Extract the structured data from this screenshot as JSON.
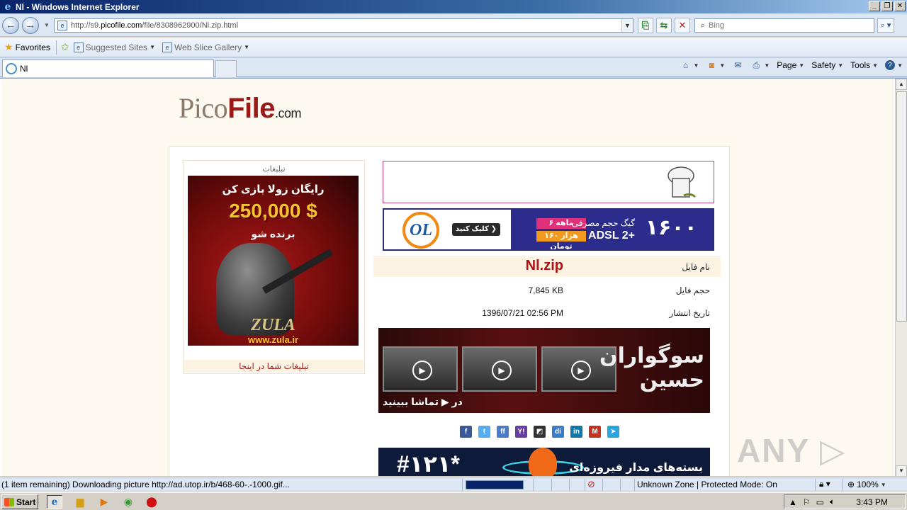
{
  "window": {
    "title": "Nl - Windows Internet Explorer",
    "controls": [
      "_",
      "❐",
      "✕"
    ]
  },
  "address_bar": {
    "url_prefix": "http://s9.",
    "url_domain": "picofile.com",
    "url_path": "/file/8308962900/Nl.zip.html",
    "search_placeholder": "Bing"
  },
  "favorites_bar": {
    "favorites_label": "Favorites",
    "suggested_sites": "Suggested Sites",
    "web_slice_gallery": "Web Slice Gallery"
  },
  "tabs": [
    {
      "label": "Nl"
    }
  ],
  "command_bar": {
    "page": "Page",
    "safety": "Safety",
    "tools": "Tools"
  },
  "page": {
    "logo": {
      "pico": "Pico",
      "file": "File",
      "com": ".com"
    },
    "left_ad": {
      "title": "تبلیغات",
      "line1": "رایگان زولا بازی کن",
      "line2": "250,000 $",
      "line3": "برنده شو",
      "brand": "ZULA",
      "url": "www.zula.ir",
      "footer": "تبلیغات شما در اینجا"
    },
    "adsl_banner": {
      "number": "۱۶۰۰",
      "gig_label": "گیگ حجم مصرفی",
      "adsl": "ADSL 2+",
      "pill1": "۶ ماهه",
      "pill2": "۱۶۰ هزار تومان",
      "click": "کلیک کنید ❯",
      "brand": "OL"
    },
    "file_info": {
      "name_label": "نام فایل",
      "name_value": "Nl.zip",
      "size_label": "حجم فایل",
      "size_value": "7,845 KB",
      "date_label": "تاریخ انتشار",
      "date_value": "1396/07/21 02:56 PM"
    },
    "muharram_banner": {
      "line1": "سوگواران",
      "line2": "حسین",
      "watch": "در ▶ تماشا ببینید"
    },
    "bottom_banner": {
      "hash": "#۱۲۱*",
      "text": "بسته‌های مدار فیروزه‌ای"
    },
    "watermark": "ANY ▷ RUN"
  },
  "share_icons": [
    {
      "name": "facebook",
      "glyph": "f",
      "color": "#3b5998"
    },
    {
      "name": "twitter",
      "glyph": "t",
      "color": "#55acee"
    },
    {
      "name": "friendfeed",
      "glyph": "ff",
      "color": "#4a7cc8"
    },
    {
      "name": "yahoo",
      "glyph": "Y!",
      "color": "#6a3ea0"
    },
    {
      "name": "delicious",
      "glyph": "◩",
      "color": "#333333"
    },
    {
      "name": "diigo",
      "glyph": "di",
      "color": "#3a7cc8"
    },
    {
      "name": "linkedin",
      "glyph": "in",
      "color": "#0e76a8"
    },
    {
      "name": "gmail",
      "glyph": "M",
      "color": "#c23321"
    },
    {
      "name": "telegram",
      "glyph": "➤",
      "color": "#2ca5e0"
    }
  ],
  "status_bar": {
    "text": "(1 item remaining) Downloading picture http://ad.utop.ir/b/468-60-.-1000.gif...",
    "progress": 1.0,
    "zone": "Unknown Zone | Protected Mode: On",
    "zoom": "100%"
  },
  "taskbar": {
    "start": "Start",
    "clock": "3:43 PM"
  }
}
